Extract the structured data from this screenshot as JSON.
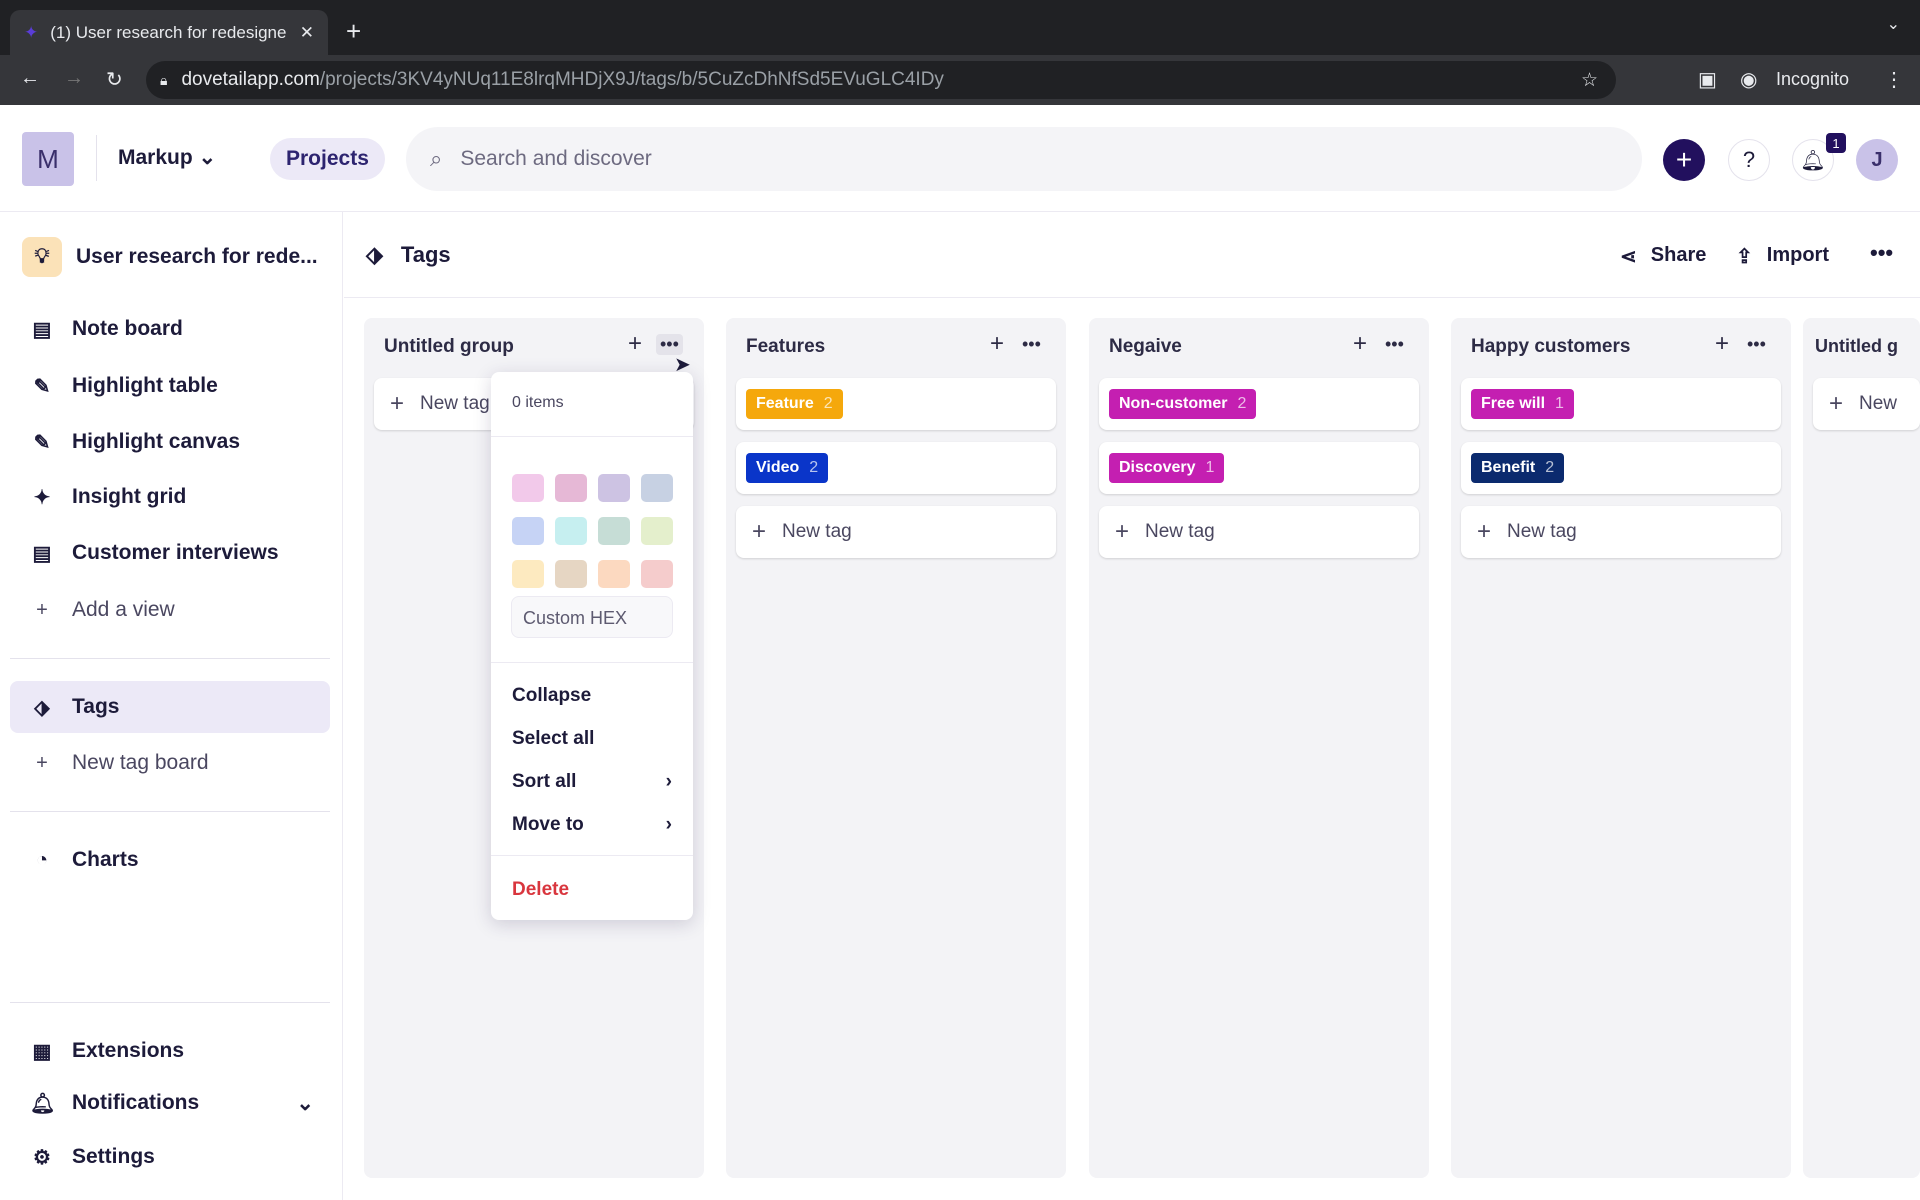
{
  "browser": {
    "tab_title": "(1) User research for redesigne",
    "url_host": "dovetailapp.com",
    "url_path": "/projects/3KV4yNUq11E8lrqMHDjX9J/tags/b/5CuZcDhNfSd5EVuGLC4IDy",
    "profile": "Incognito"
  },
  "header": {
    "workspace_initial": "M",
    "workspace": "Markup",
    "projects": "Projects",
    "search_placeholder": "Search and discover",
    "notification_count": "1",
    "avatar": "J"
  },
  "sidebar": {
    "project": "User research for rede...",
    "items": [
      {
        "label": "Note board",
        "icon": "document-icon"
      },
      {
        "label": "Highlight table",
        "icon": "highlighter-icon"
      },
      {
        "label": "Highlight canvas",
        "icon": "highlighter-icon"
      },
      {
        "label": "Insight grid",
        "icon": "sparkle-icon"
      },
      {
        "label": "Customer interviews",
        "icon": "document-icon"
      }
    ],
    "add_view": "Add a view",
    "tags": "Tags",
    "new_tag_board": "New tag board",
    "charts": "Charts",
    "extensions": "Extensions",
    "notifications": "Notifications",
    "settings": "Settings"
  },
  "page": {
    "title": "Tags",
    "share": "Share",
    "import": "Import"
  },
  "columns": [
    {
      "title": "Untitled group",
      "tags": [],
      "new_tag": "New tag"
    },
    {
      "title": "Features",
      "tags": [
        {
          "label": "Feature",
          "count": "2",
          "color": "#f5a80c"
        },
        {
          "label": "Video",
          "count": "2",
          "color": "#0a35c9"
        }
      ],
      "new_tag": "New tag"
    },
    {
      "title": "Negaive",
      "tags": [
        {
          "label": "Non-customer",
          "count": "2",
          "color": "#c41fb1"
        },
        {
          "label": "Discovery",
          "count": "1",
          "color": "#c41fb1"
        }
      ],
      "new_tag": "New tag"
    },
    {
      "title": "Happy customers",
      "tags": [
        {
          "label": "Free will",
          "count": "1",
          "color": "#c41fb1"
        },
        {
          "label": "Benefit",
          "count": "2",
          "color": "#0b2a6e"
        }
      ],
      "new_tag": "New tag"
    },
    {
      "title": "Untitled g",
      "tags": [],
      "new_tag": "New"
    }
  ],
  "menu": {
    "count": "0 items",
    "swatches": [
      "#f2c9ea",
      "#e6b8d6",
      "#cdc3e3",
      "#c7d1e3",
      "#c6d3f5",
      "#c6eff0",
      "#c6ddd6",
      "#e4efcc",
      "#fdeac0",
      "#e6d6c3",
      "#fcd9c0",
      "#f5cccc"
    ],
    "custom_hex": "Custom HEX",
    "collapse": "Collapse",
    "select_all": "Select all",
    "sort_all": "Sort all",
    "move_to": "Move to",
    "delete": "Delete"
  }
}
